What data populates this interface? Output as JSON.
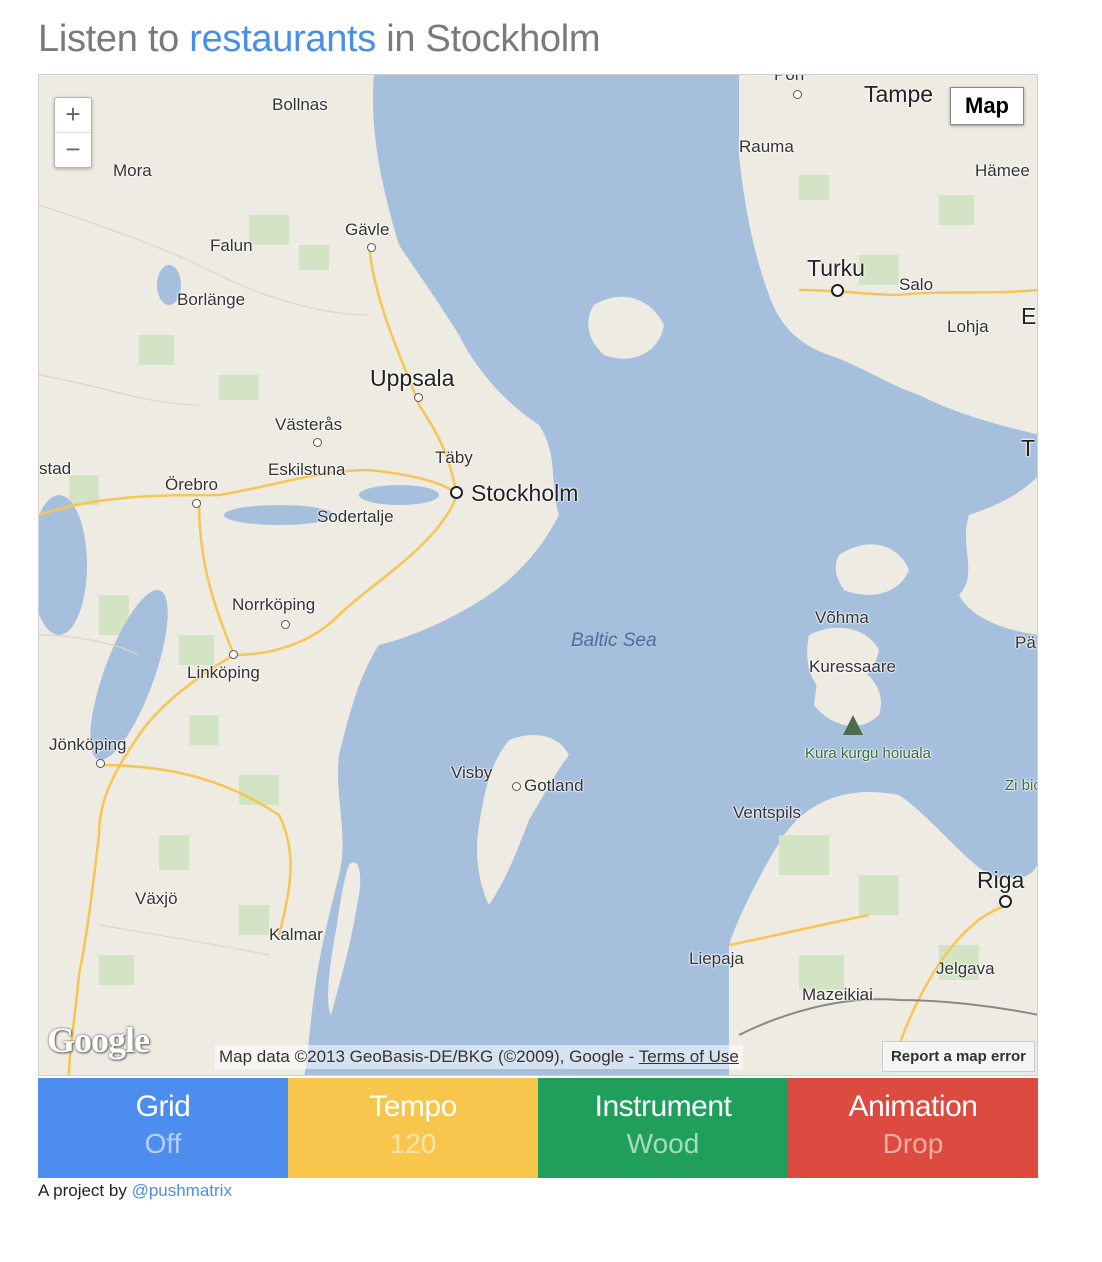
{
  "header": {
    "prefix": "Listen to",
    "category": "restaurants",
    "middle": "in",
    "city": "Stockholm"
  },
  "map": {
    "zoom_in": "+",
    "zoom_out": "−",
    "map_type": "Map",
    "logo": "Google",
    "attribution": "Map data ©2013 GeoBasis-DE/BKG (©2009), Google -",
    "terms": "Terms of Use",
    "report": "Report a map error",
    "places": [
      "Pori",
      "Tampe",
      "Rauma",
      "Hämee",
      "Turku",
      "Salo",
      "Lohja",
      "E",
      "Bollnas",
      "Mora",
      "Gävle",
      "Falun",
      "Borlänge",
      "Uppsala",
      "Västerås",
      "Täby",
      "Eskilstuna",
      "Stockholm",
      "stad",
      "Örebro",
      "Sodertalje",
      "T",
      "Norrköping",
      "Baltic Sea",
      "Võhma",
      "Pä",
      "Kuressaare",
      "Linköping",
      "Kura kurgu hoiuala",
      "Jönköping",
      "Visby",
      "Gotland",
      "Zi bios",
      "Ventspils",
      "Riga",
      "Växjö",
      "Kalmar",
      "Liepaja",
      "Jelgava",
      "Mazeikiai"
    ]
  },
  "controls": [
    {
      "name": "Grid",
      "value": "Off"
    },
    {
      "name": "Tempo",
      "value": "120"
    },
    {
      "name": "Instrument",
      "value": "Wood"
    },
    {
      "name": "Animation",
      "value": "Drop"
    }
  ],
  "footer": {
    "text": "A project by",
    "handle": "@pushmatrix"
  },
  "colors": {
    "link": "#4a8ee6",
    "water": "#a5bfdd",
    "land": "#eeebe3",
    "grid": "#4d8df0",
    "tempo": "#f8c64c",
    "instrument": "#1f9e5c",
    "animation": "#dc4a40"
  }
}
